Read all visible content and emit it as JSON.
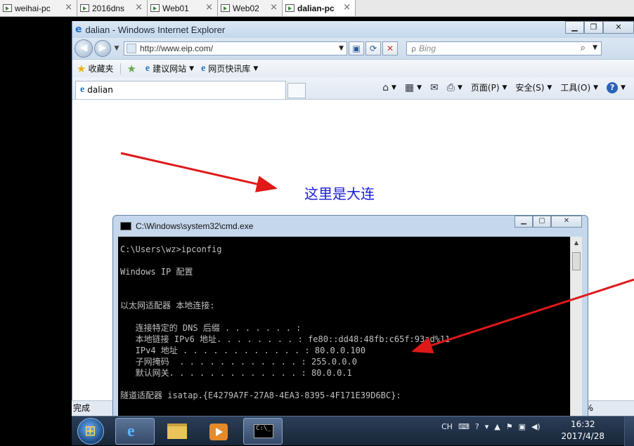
{
  "vm_tabs": [
    {
      "label": "weihai-pc",
      "close": "×"
    },
    {
      "label": "2016dns",
      "close": "×"
    },
    {
      "label": "Web01",
      "close": "×"
    },
    {
      "label": "Web02",
      "close": "×"
    },
    {
      "label": "dalian-pc",
      "close": "×"
    }
  ],
  "ie": {
    "window_title": "dalian - Windows Internet Explorer",
    "address": "http://www.eip.com/",
    "search_placeholder": "Bing",
    "favorites": {
      "favorites_label": "收藏夹",
      "suggested_sites": "建议网站",
      "web_slice_gallery": "网页快讯库"
    },
    "tab_title": "dalian",
    "commands": {
      "page": "页面(P)",
      "safety": "安全(S)",
      "tools": "工具(O)"
    },
    "page_heading": "这里是大连",
    "status_text": "完成",
    "zoom": "0%"
  },
  "cmd": {
    "title": "C:\\Windows\\system32\\cmd.exe",
    "lines": [
      "C:\\Users\\wz>ipconfig",
      "",
      "Windows IP 配置",
      "",
      "",
      "以太网适配器 本地连接:",
      "",
      "   连接特定的 DNS 后缀 . . . . . . . :",
      "   本地链接 IPv6 地址. . . . . . . . : fe80::dd48:48fb:c65f:93ad%11",
      "   IPv4 地址 . . . . . . . . . . . . : 80.0.0.100",
      "   子网掩码  . . . . . . . . . . . . : 255.0.0.0",
      "   默认网关. . . . . . . . . . . . . : 80.0.0.1",
      "",
      "隧道适配器 isatap.{E4279A7F-27A8-4EA3-8395-4F171E39D6BC}:"
    ]
  },
  "taskbar": {
    "lang": "CH",
    "time": "16:32",
    "date": "2017/4/28"
  },
  "colors": {
    "arrow": "#e01818",
    "heading": "#1a1ae0"
  }
}
